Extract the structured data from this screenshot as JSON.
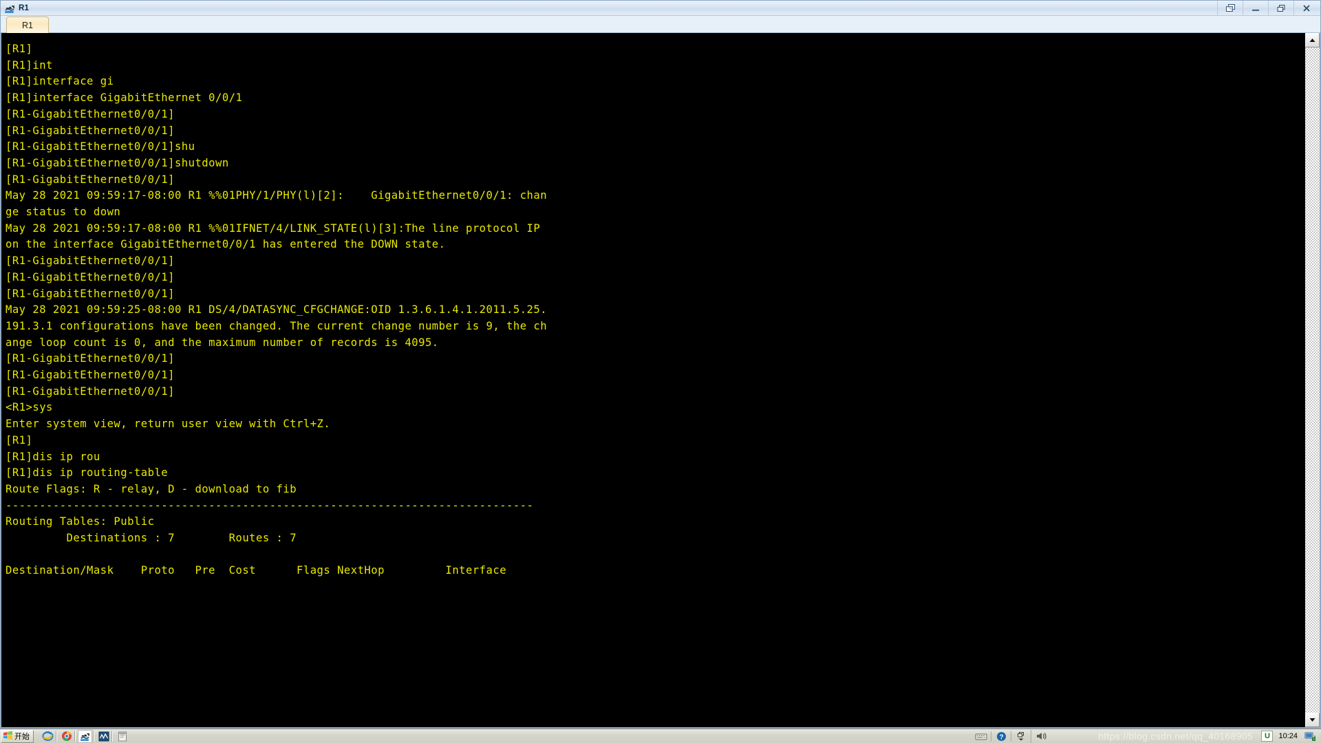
{
  "window": {
    "title": "R1",
    "title_icon": "ensp-router-icon",
    "controls": [
      {
        "name": "restore-window-button",
        "icon": "cascade-windows-icon",
        "label": ""
      },
      {
        "name": "minimize-button",
        "icon": "minimize-icon",
        "label": "_"
      },
      {
        "name": "maximize-button",
        "icon": "maximize-restore-icon",
        "label": ""
      },
      {
        "name": "close-button",
        "icon": "close-icon",
        "label": "X"
      }
    ]
  },
  "tabs": [
    {
      "label": "R1",
      "active": true
    }
  ],
  "terminal": {
    "foreground_color": "#e8e800",
    "background_color": "#000000",
    "lines": [
      "[R1]",
      "[R1]int",
      "[R1]interface gi",
      "[R1]interface GigabitEthernet 0/0/1",
      "[R1-GigabitEthernet0/0/1]",
      "[R1-GigabitEthernet0/0/1]",
      "[R1-GigabitEthernet0/0/1]shu",
      "[R1-GigabitEthernet0/0/1]shutdown",
      "[R1-GigabitEthernet0/0/1]",
      "May 28 2021 09:59:17-08:00 R1 %%01PHY/1/PHY(l)[2]:    GigabitEthernet0/0/1: chan",
      "ge status to down",
      "May 28 2021 09:59:17-08:00 R1 %%01IFNET/4/LINK_STATE(l)[3]:The line protocol IP",
      "on the interface GigabitEthernet0/0/1 has entered the DOWN state.",
      "[R1-GigabitEthernet0/0/1]",
      "[R1-GigabitEthernet0/0/1]",
      "[R1-GigabitEthernet0/0/1]",
      "May 28 2021 09:59:25-08:00 R1 DS/4/DATASYNC_CFGCHANGE:OID 1.3.6.1.4.1.2011.5.25.",
      "191.3.1 configurations have been changed. The current change number is 9, the ch",
      "ange loop count is 0, and the maximum number of records is 4095.",
      "[R1-GigabitEthernet0/0/1]",
      "[R1-GigabitEthernet0/0/1]",
      "[R1-GigabitEthernet0/0/1]",
      "<R1>sys",
      "Enter system view, return user view with Ctrl+Z.",
      "[R1]",
      "[R1]dis ip rou",
      "[R1]dis ip routing-table",
      "Route Flags: R - relay, D - download to fib",
      "------------------------------------------------------------------------------",
      "Routing Tables: Public",
      "         Destinations : 7        Routes : 7",
      "",
      "Destination/Mask    Proto   Pre  Cost      Flags NextHop         Interface"
    ]
  },
  "scrollbar": {
    "up_arrow": "scroll-up-arrow-icon",
    "down_arrow": "scroll-down-arrow-icon"
  },
  "taskbar": {
    "start_label": "开始",
    "start_icon": "windows-logo-icon",
    "quick_launch": [
      {
        "name": "internet-explorer-icon",
        "glyph": "e"
      },
      {
        "name": "google-chrome-icon",
        "glyph": ""
      },
      {
        "name": "ensp-icon",
        "glyph": "",
        "active": true
      },
      {
        "name": "wireshark-icon",
        "glyph": ""
      },
      {
        "name": "notepad-icon",
        "glyph": ""
      }
    ],
    "tray": {
      "icons": [
        {
          "name": "keyboard-icon"
        },
        {
          "name": "help-icon"
        },
        {
          "name": "show-hidden-icons-icon"
        },
        {
          "name": "volume-icon"
        }
      ],
      "ime_label": "U",
      "clock": "10:24",
      "network_icon": "network-icon"
    },
    "watermark": "https://blog.csdn.net/qq_40168905"
  }
}
